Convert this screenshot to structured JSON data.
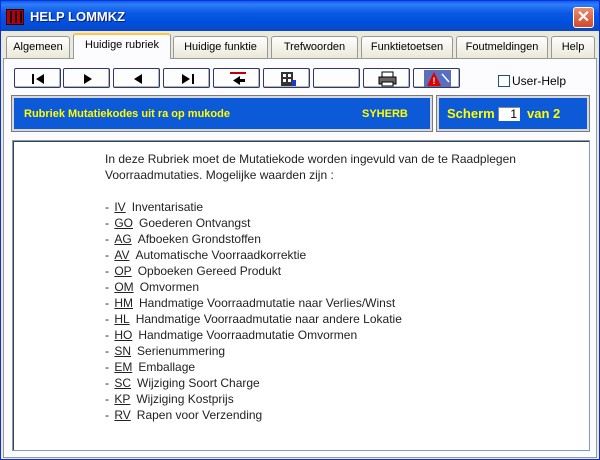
{
  "window": {
    "title": "HELP LOMMKZ",
    "close_glyph": "✕"
  },
  "tabs": [
    {
      "label": "Algemeen"
    },
    {
      "label": "Huidige rubriek",
      "active": true
    },
    {
      "label": "Huidige funktie"
    },
    {
      "label": "Trefwoorden"
    },
    {
      "label": "Funktietoetsen"
    },
    {
      "label": "Foutmeldingen"
    },
    {
      "label": "Help"
    }
  ],
  "toolbar": {
    "buttons": [
      {
        "icon": "first-page-icon"
      },
      {
        "icon": "next-icon"
      },
      {
        "icon": "previous-icon"
      },
      {
        "icon": "last-page-icon"
      },
      {
        "icon": "back-icon"
      },
      {
        "icon": "grid-icon"
      },
      {
        "icon": "blank"
      },
      {
        "icon": "printer-icon"
      },
      {
        "icon": "alert-icon"
      }
    ],
    "user_help_label": "User-Help"
  },
  "header": {
    "rubriek_title": "Rubriek Mutatiekodes uit ra op mukode",
    "code": "SYHERB",
    "scherm_label": "Scherm",
    "scherm_value": "1",
    "scherm_total": "van 2"
  },
  "content": {
    "intro": "In deze Rubriek moet de Mutatiekode worden ingevuld van de te Raadplegen Voorraadmutaties. Mogelijke waarden zijn :",
    "items": [
      {
        "code": "IV",
        "description": "Inventarisatie"
      },
      {
        "code": "GO",
        "description": "Goederen Ontvangst"
      },
      {
        "code": "AG",
        "description": "Afboeken Grondstoffen"
      },
      {
        "code": "AV",
        "description": "Automatische Voorraadkorrektie"
      },
      {
        "code": "OP",
        "description": "Opboeken Gereed Produkt"
      },
      {
        "code": "OM",
        "description": "Omvormen"
      },
      {
        "code": "HM",
        "description": "Handmatige Voorraadmutatie naar Verlies/Winst"
      },
      {
        "code": "HL",
        "description": "Handmatige Voorraadmutatie naar andere Lokatie"
      },
      {
        "code": "HO",
        "description": "Handmatige Voorraadmutatie Omvormen"
      },
      {
        "code": "SN",
        "description": "Serienummering"
      },
      {
        "code": "EM",
        "description": "Emballage"
      },
      {
        "code": "SC",
        "description": "Wijziging Soort Charge"
      },
      {
        "code": "KP",
        "description": "Wijziging Kostprijs"
      },
      {
        "code": "RV",
        "description": "Rapen voor Verzending"
      }
    ]
  },
  "colors": {
    "header_bg": "#0d5ad8",
    "header_text": "#ffff00",
    "titlebar": "#0050de"
  }
}
